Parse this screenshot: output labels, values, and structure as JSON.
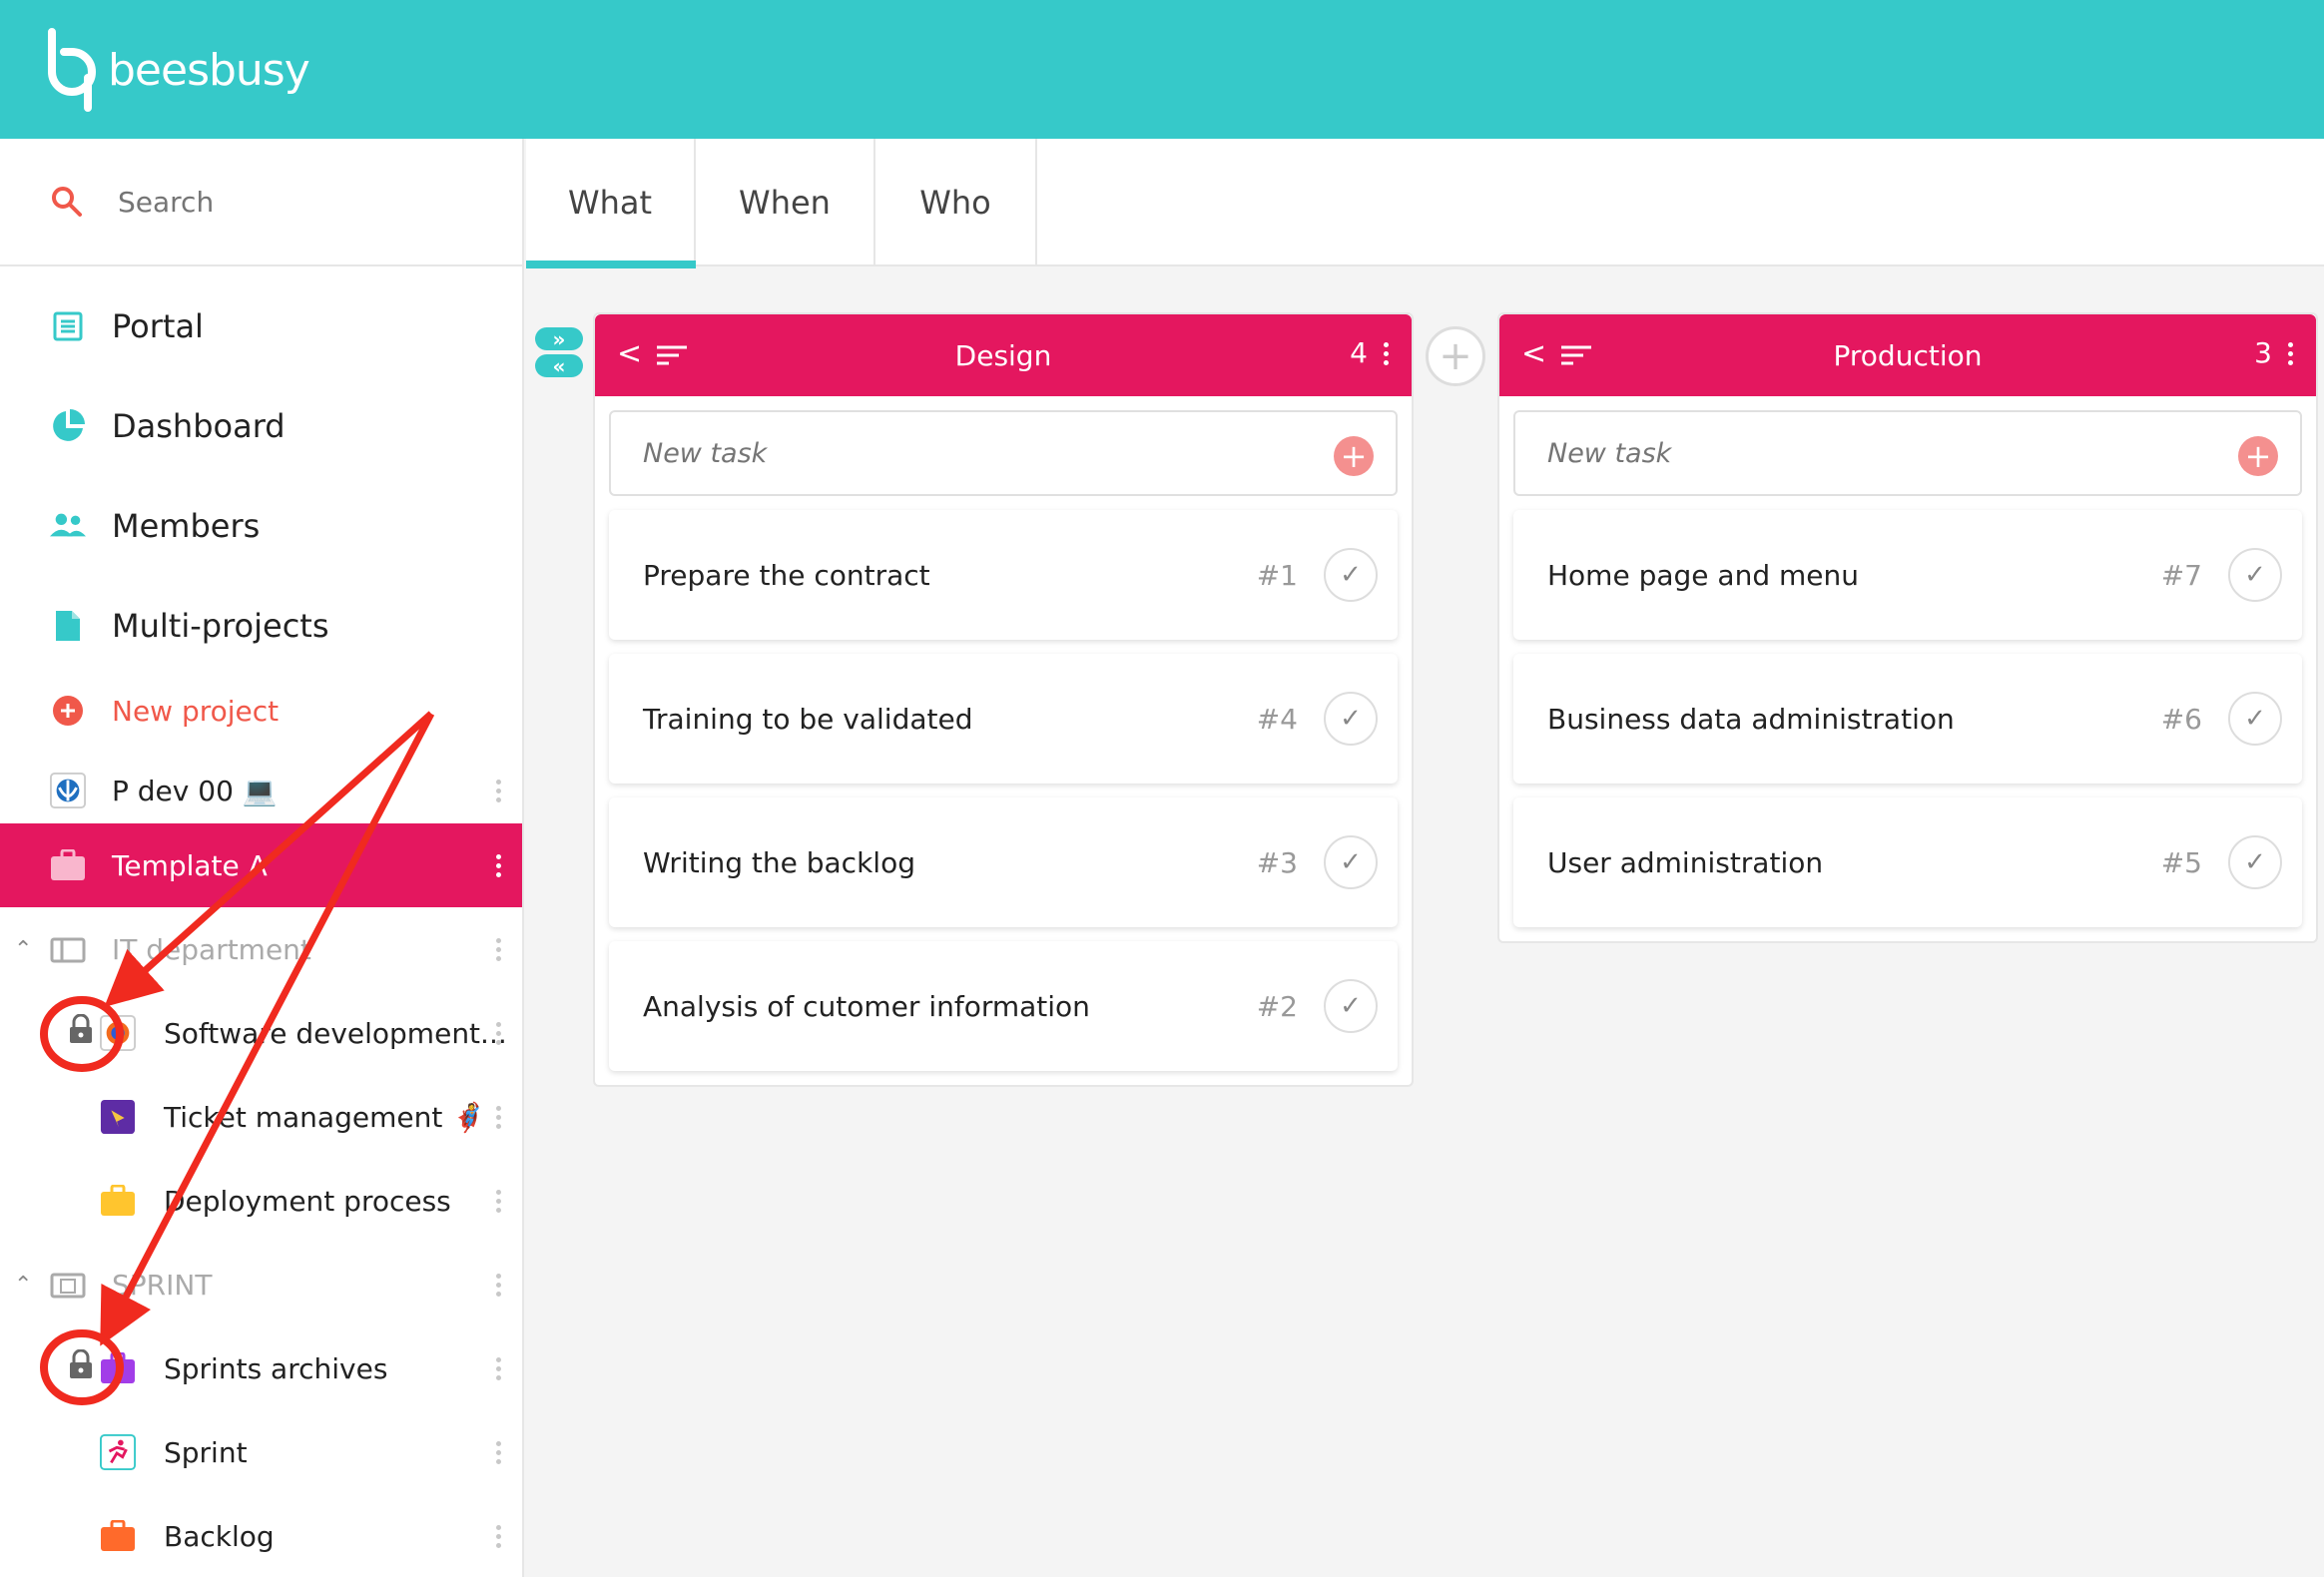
{
  "app": {
    "logo_text": "beesbusy"
  },
  "search": {
    "placeholder": "Search"
  },
  "sidebar": {
    "nav": [
      {
        "label": "Portal",
        "icon": "list-icon"
      },
      {
        "label": "Dashboard",
        "icon": "pie-chart-icon"
      },
      {
        "label": "Members",
        "icon": "people-icon"
      },
      {
        "label": "Multi-projects",
        "icon": "document-icon"
      }
    ],
    "new_project": "New project",
    "projects": [
      {
        "label": "P dev 00 💻",
        "icon": "rebel-icon"
      },
      {
        "label": "Template A",
        "icon": "briefcase-icon",
        "active": true
      }
    ],
    "groups": [
      {
        "label": "IT department",
        "items": [
          {
            "label": "Software development...",
            "locked": true
          },
          {
            "label": "Ticket management 🦸"
          },
          {
            "label": "Deployment process"
          }
        ]
      },
      {
        "label": "SPRINT",
        "items": [
          {
            "label": "Sprints archives",
            "locked": true
          },
          {
            "label": "Sprint"
          },
          {
            "label": "Backlog"
          }
        ]
      }
    ]
  },
  "tabs": [
    "What",
    "When",
    "Who"
  ],
  "columns": [
    {
      "title": "Design",
      "count": "4",
      "new_task_placeholder": "New task",
      "cards": [
        {
          "title": "Prepare the contract",
          "num": "#1"
        },
        {
          "title": "Training to be validated",
          "num": "#4"
        },
        {
          "title": "Writing the backlog",
          "num": "#3"
        },
        {
          "title": "Analysis of cutomer information",
          "num": "#2"
        }
      ]
    },
    {
      "title": "Production",
      "count": "3",
      "new_task_placeholder": "New task",
      "cards": [
        {
          "title": "Home page and menu",
          "num": "#7"
        },
        {
          "title": "Business data administration",
          "num": "#6"
        },
        {
          "title": "User administration",
          "num": "#5"
        }
      ]
    }
  ],
  "colors": {
    "teal": "#36c9c9",
    "pink": "#e4175f",
    "red_annotation": "#f02a1f"
  }
}
